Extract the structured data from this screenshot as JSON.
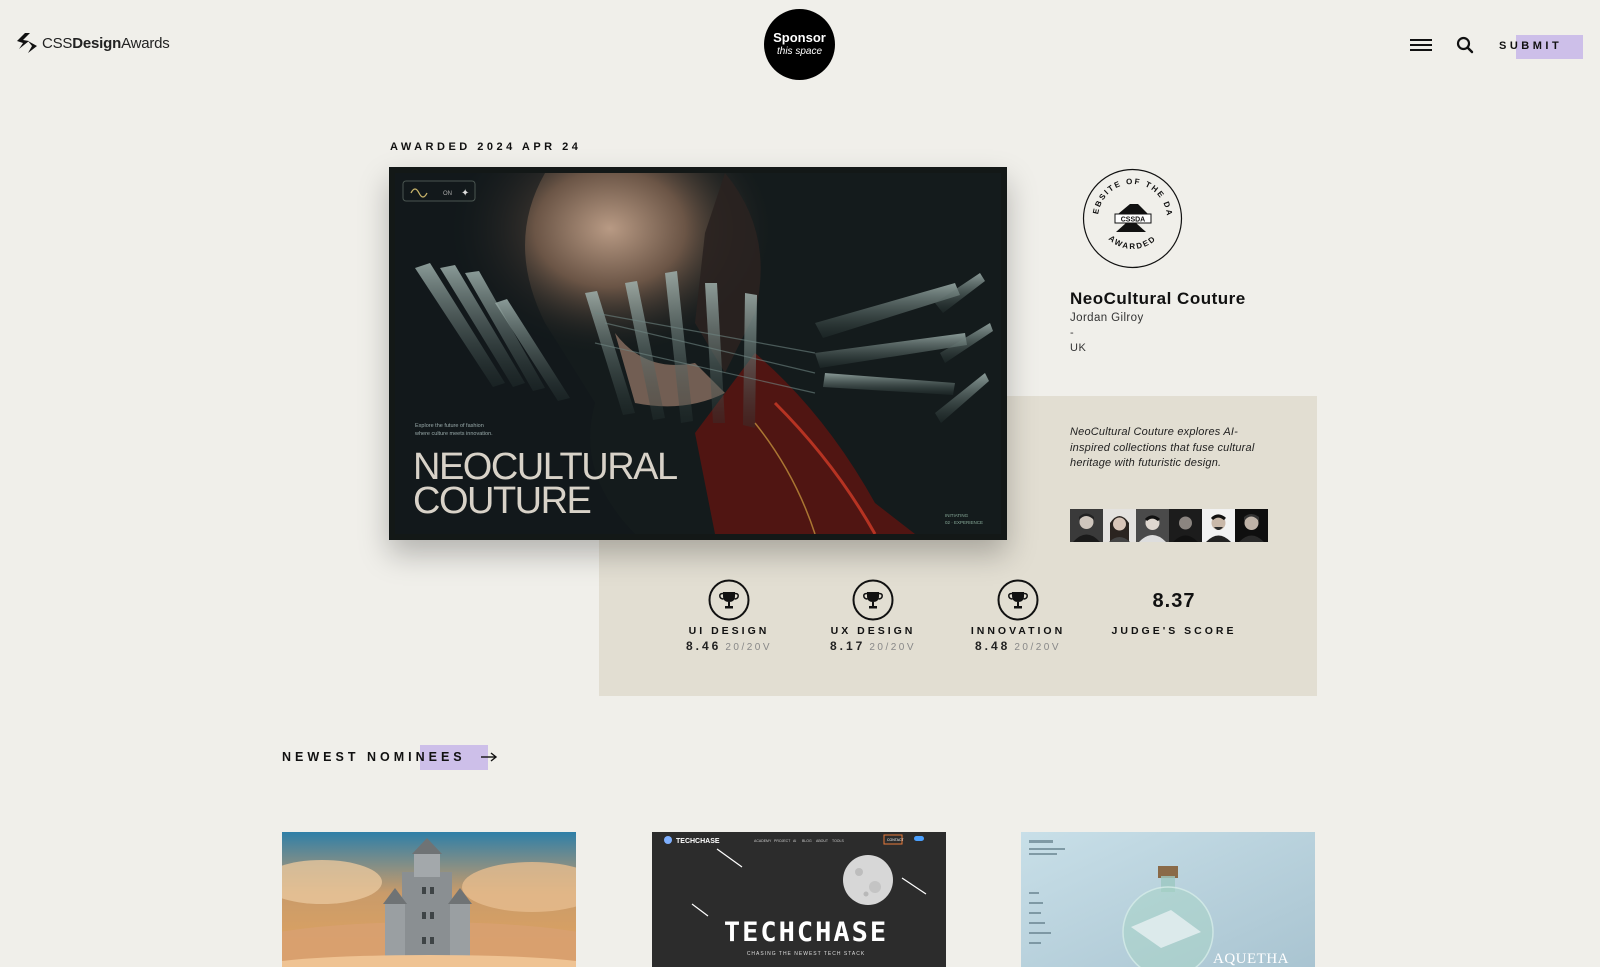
{
  "header": {
    "logo": {
      "prefix": "CSS",
      "bold": "Design",
      "suffix": "Awards"
    },
    "sponsor": {
      "line1": "Sponsor",
      "line2": "this space"
    },
    "menu_icon": "hamburger-menu-icon",
    "search_icon": "search-icon",
    "submit_label": "SUBMIT",
    "accent_color": "#cdbfe9"
  },
  "feature": {
    "awarded_label": "AWARDED 2024 APR 24",
    "badge": {
      "ring_top": "WEBSITE OF THE DAY",
      "ring_bottom": "AWARDED",
      "center": "CSSDA"
    },
    "site_name": "NeoCultural Couture",
    "author": "Jordan Gilroy",
    "separator": "-",
    "country": "UK",
    "description": "NeoCultural Couture explores AI-inspired collections that fuse cultural heritage with futuristic design.",
    "hero": {
      "title_line1": "NEOCULTURAL",
      "title_line2": "COUTURE",
      "tagline_line1": "Explore the future of fashion",
      "tagline_line2": "where culture meets innovation.",
      "corner_line1": "INITIATING",
      "corner_line2": "02 · EXPERIENCE",
      "toggle_label": "ON"
    },
    "judges_count": 6,
    "scores": [
      {
        "label": "UI DESIGN",
        "value": "8.46",
        "votes": "20/20V"
      },
      {
        "label": "UX DESIGN",
        "value": "8.17",
        "votes": "20/20V"
      },
      {
        "label": "INNOVATION",
        "value": "8.48",
        "votes": "20/20V"
      }
    ],
    "judges_score": {
      "value": "8.37",
      "label": "JUDGE'S SCORE"
    }
  },
  "nominees": {
    "title": "NEWEST NOMINEES",
    "arrow_icon": "arrow-right-icon",
    "cards": [
      {
        "name": "castle-in-clouds"
      },
      {
        "name": "techchase",
        "brand": "TECHCHASE",
        "nav": [
          "ACADEMY",
          "PROJECT",
          "AI",
          "BLOG",
          "ABOUT",
          "TOOLS"
        ],
        "cta": "CONTACT",
        "headline": "TECHCHASE",
        "tagline": "CHASING THE NEWEST TECH STACK"
      },
      {
        "name": "aquetha",
        "brand": "AQUETHA"
      }
    ]
  }
}
